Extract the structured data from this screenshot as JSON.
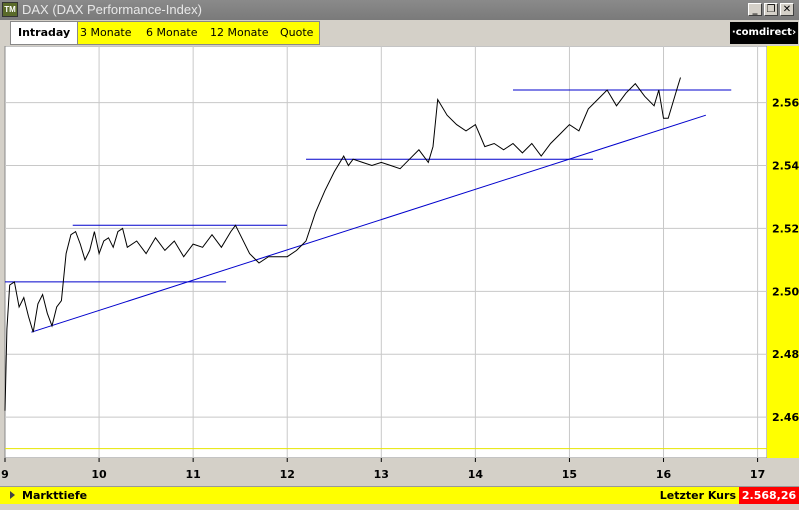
{
  "window": {
    "icon_label": "TM",
    "title": "DAX (DAX Performance-Index)",
    "buttons": {
      "minimize": "_",
      "restore": "❐",
      "close": "✕"
    }
  },
  "tabs": [
    {
      "label": "Intraday",
      "active": true
    },
    {
      "label": "3 Monate",
      "active": false
    },
    {
      "label": "6 Monate",
      "active": false
    },
    {
      "label": "12 Monate",
      "active": false
    },
    {
      "label": "Quote",
      "active": false
    }
  ],
  "logo": {
    "text": "·comdirect›"
  },
  "bottom": {
    "left_label": "Markttiefe",
    "right_label": "Letzter Kurs",
    "last_value": "2.568,26"
  },
  "colors": {
    "plot_bg": "#ffffff",
    "axis_bg": "#ffff00",
    "price_line": "#000000",
    "trend_lines": "#0000cc",
    "grid": "#c8c8c8",
    "base_line": "#e6e600",
    "last_price_bg": "#ff0000"
  },
  "chart_data": {
    "type": "line",
    "title": "",
    "xlabel": "",
    "ylabel": "",
    "xlim": [
      9,
      17.1
    ],
    "ylim": [
      2447,
      2578
    ],
    "x_ticks": [
      "9",
      "10",
      "11",
      "12",
      "13",
      "14",
      "15",
      "16",
      "17"
    ],
    "x_tick_values": [
      9,
      10,
      11,
      12,
      13,
      14,
      15,
      16,
      17
    ],
    "y_ticks": [
      "2.460",
      "2.480",
      "2.500",
      "2.520",
      "2.540",
      "2.560"
    ],
    "y_tick_values": [
      2460,
      2480,
      2500,
      2520,
      2540,
      2560
    ],
    "grid": true,
    "reference_line_y": 2450,
    "series": [
      {
        "x": [
          9.0,
          9.02,
          9.05,
          9.1,
          9.15,
          9.2,
          9.25,
          9.3,
          9.35,
          9.4,
          9.45,
          9.5,
          9.55,
          9.6,
          9.65,
          9.7,
          9.75,
          9.8,
          9.85,
          9.9,
          9.95,
          10.0,
          10.05,
          10.1,
          10.15,
          10.2,
          10.25,
          10.3,
          10.4,
          10.5,
          10.6,
          10.7,
          10.8,
          10.9,
          11.0,
          11.1,
          11.2,
          11.3,
          11.4,
          11.45,
          11.5,
          11.6,
          11.7,
          11.8,
          11.9,
          12.0,
          12.1,
          12.2,
          12.3,
          12.4,
          12.5,
          12.6,
          12.65,
          12.7,
          12.8,
          12.9,
          13.0,
          13.1,
          13.2,
          13.3,
          13.4,
          13.5,
          13.55,
          13.6,
          13.7,
          13.8,
          13.9,
          14.0,
          14.1,
          14.2,
          14.3,
          14.4,
          14.5,
          14.6,
          14.7,
          14.8,
          14.9,
          15.0,
          15.1,
          15.2,
          15.3,
          15.4,
          15.5,
          15.6,
          15.7,
          15.8,
          15.9,
          15.95,
          16.0,
          16.05,
          16.1,
          16.15,
          16.18
        ],
        "y": [
          2462,
          2488,
          2502,
          2503,
          2495,
          2498,
          2492,
          2487,
          2496,
          2499,
          2493,
          2489,
          2495,
          2497,
          2512,
          2518,
          2519,
          2515,
          2510,
          2513,
          2519,
          2512,
          2516,
          2517,
          2514,
          2519,
          2520,
          2514,
          2516,
          2512,
          2517,
          2513,
          2516,
          2511,
          2515,
          2514,
          2518,
          2514,
          2519,
          2521,
          2518,
          2512,
          2509,
          2511,
          2511,
          2511,
          2513,
          2516,
          2525,
          2532,
          2538,
          2543,
          2540,
          2542,
          2541,
          2540,
          2541,
          2540,
          2539,
          2542,
          2545,
          2541,
          2546,
          2561,
          2556,
          2553,
          2551,
          2553,
          2546,
          2547,
          2545,
          2547,
          2544,
          2547,
          2543,
          2547,
          2550,
          2553,
          2551,
          2558,
          2561,
          2564,
          2559,
          2563,
          2566,
          2562,
          2559,
          2564,
          2555,
          2555,
          2560,
          2565,
          2568
        ]
      }
    ],
    "trend_lines": [
      {
        "x": [
          9.0,
          11.35
        ],
        "y": [
          2503,
          2503
        ]
      },
      {
        "x": [
          9.72,
          12.0
        ],
        "y": [
          2521,
          2521
        ]
      },
      {
        "x": [
          12.2,
          15.25
        ],
        "y": [
          2542,
          2542
        ]
      },
      {
        "x": [
          14.4,
          16.72
        ],
        "y": [
          2564,
          2564
        ]
      },
      {
        "x": [
          9.28,
          16.45
        ],
        "y": [
          2487,
          2556
        ]
      }
    ]
  }
}
